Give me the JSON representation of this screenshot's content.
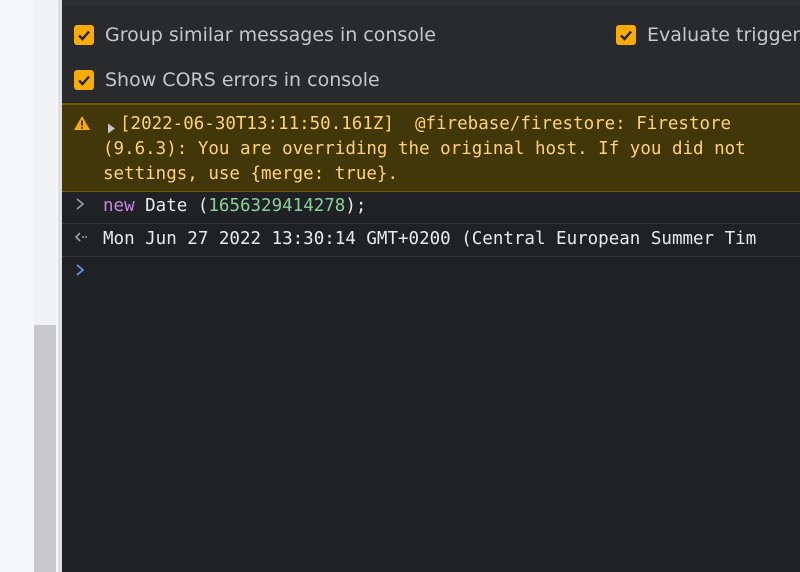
{
  "settings": {
    "group_similar_label": "Group similar messages in console",
    "evaluate_triggers_label": "Evaluate triggers",
    "show_cors_label": "Show CORS errors in console"
  },
  "console": {
    "warning": {
      "line1": "[2022-06-30T13:11:50.161Z]  @firebase/firestore: Firestore",
      "line2": "(9.6.3): You are overriding the original host. If you did not",
      "line3": "settings, use {merge: true}."
    },
    "input": {
      "keyword": "new",
      "text": " Date (",
      "number": "1656329414278",
      "tail": ");"
    },
    "output": {
      "text": "Mon Jun 27 2022 13:30:14 GMT+0200 (Central European Summer Tim"
    },
    "prompt_value": ""
  },
  "icons": {
    "checkbox": "checkbox-checked-icon",
    "warning": "warning-icon",
    "expand": "triangle-right-icon",
    "input_arrow": "chevron-right-icon",
    "output_arrow": "return-arrow-icon",
    "prompt": "prompt-chevron-icon"
  },
  "colors": {
    "accent": "#f9ab00",
    "warning_bg": "#413709",
    "warning_text": "#fdd27a",
    "panel_bg": "#202124",
    "keyword": "#c587e4",
    "number": "#88d19b",
    "prompt": "#5e8ee8"
  }
}
